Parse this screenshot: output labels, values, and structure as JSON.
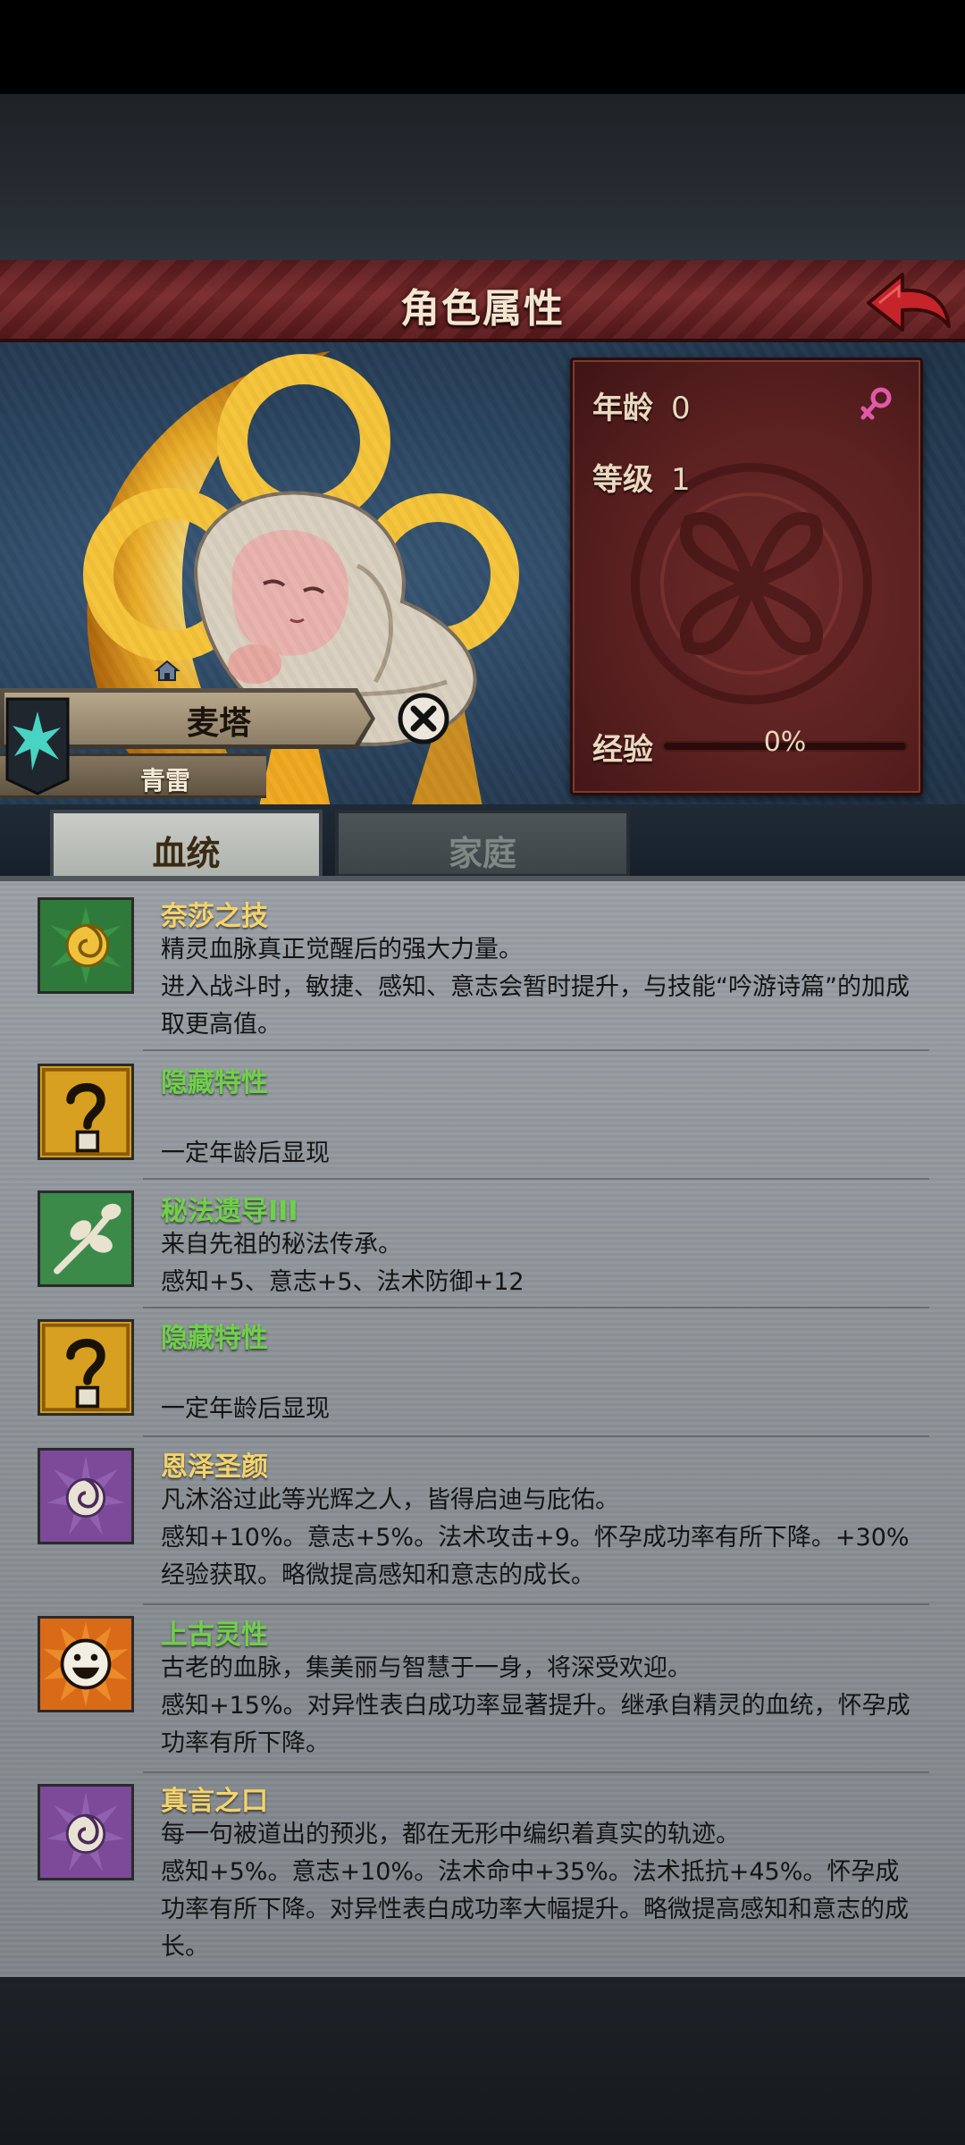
{
  "header": {
    "title": "角色属性",
    "back_label": ""
  },
  "stats": {
    "age_label": "年龄",
    "age_value": "0",
    "level_label": "等级",
    "level_value": "1",
    "exp_label": "经验",
    "exp_value": "0%",
    "exp_progress": 0,
    "gender_icon": "female-icon"
  },
  "character": {
    "name": "麦塔",
    "class": "青雷"
  },
  "tabs": [
    {
      "label": "血统",
      "active": true
    },
    {
      "label": "家庭",
      "active": false
    }
  ],
  "traits": [
    {
      "name": "奈莎之技",
      "color": "gold",
      "icon": "golden-swirl-icon",
      "desc": [
        "精灵血脉真正觉醒后的强大力量。",
        "进入战斗时，敏捷、感知、意志会暂时提升，与技能“吟游诗篇”的加成取更高值。"
      ]
    },
    {
      "name": "隐藏特性",
      "color": "green",
      "icon": "question-mark-icon",
      "desc": [
        "",
        "一定年龄后显现"
      ]
    },
    {
      "name": "秘法遗导III",
      "color": "green",
      "icon": "branch-icon",
      "desc": [
        "来自先祖的秘法传承。",
        "感知+5、意志+5、法术防御+12"
      ]
    },
    {
      "name": "隐藏特性",
      "color": "green",
      "icon": "question-mark-icon",
      "desc": [
        "",
        "一定年龄后显现"
      ]
    },
    {
      "name": "恩泽圣颜",
      "color": "gold",
      "icon": "purple-swirl-icon",
      "desc": [
        "凡沐浴过此等光辉之人，皆得启迪与庇佑。",
        "感知+10%。意志+5%。法术攻击+9。怀孕成功率有所下降。+30%经验获取。略微提高感知和意志的成长。"
      ]
    },
    {
      "name": "上古灵性",
      "color": "green",
      "icon": "smile-face-icon",
      "desc": [
        "古老的血脉，集美丽与智慧于一身，将深受欢迎。",
        "感知+15%。对异性表白成功率显著提升。继承自精灵的血统，怀孕成功率有所下降。"
      ]
    },
    {
      "name": "真言之口",
      "color": "gold",
      "icon": "purple-swirl-icon",
      "desc": [
        "每一句被道出的预兆，都在无形中编织着真实的轨迹。",
        "感知+5%。意志+10%。法术命中+35%。法术抵抗+45%。怀孕成功率有所下降。对异性表白成功率大幅提升。略微提高感知和意志的成长。"
      ]
    }
  ]
}
